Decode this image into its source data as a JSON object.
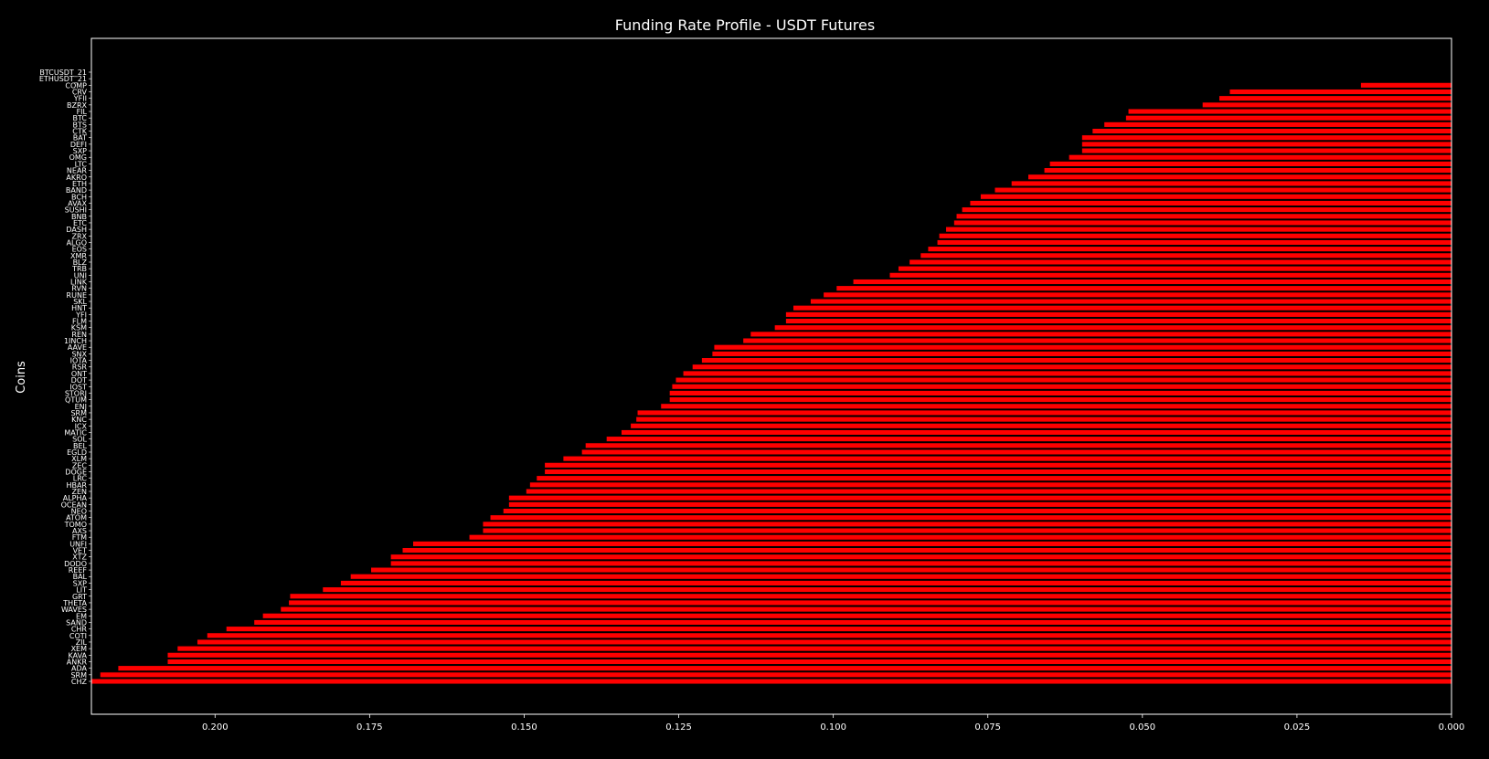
{
  "chart_data": {
    "type": "bar",
    "orientation": "horizontal",
    "title": "Funding Rate Profile - USDT Futures",
    "xlabel": "",
    "ylabel": "Coins",
    "xlim": [
      0.22,
      0.0
    ],
    "x_inverted": true,
    "grid": false,
    "legend": "none",
    "colors": {
      "background": "#000000",
      "bar": "#ff0000",
      "bar_edge": "#000000",
      "axis": "#ffffff",
      "text": "#ffffff"
    },
    "xticks": [
      0.2,
      0.175,
      0.15,
      0.125,
      0.1,
      0.075,
      0.05,
      0.025,
      0.0
    ],
    "xtick_labels": [
      "0.200",
      "0.175",
      "0.150",
      "0.125",
      "0.100",
      "0.075",
      "0.050",
      "0.025",
      "0.000"
    ],
    "categories": [
      "BTCUSDT_21",
      "ETHUSDT_21",
      "COMP",
      "CRV",
      "YFII",
      "BZRX",
      "FIL",
      "BTC",
      "BTS",
      "CTK",
      "BAT",
      "DEFI",
      "SXP",
      "OMG",
      "LTC",
      "NEAR",
      "AKRO",
      "ETH",
      "BAND",
      "BCH",
      "AVAX",
      "SUSHI",
      "BNB",
      "ETC",
      "DASH",
      "ZRX",
      "ALGO",
      "EOS",
      "XMR",
      "BLZ",
      "TRB",
      "UNI",
      "LINK",
      "RVN",
      "RUNE",
      "SKL",
      "HNT",
      "YFI",
      "FLM",
      "KSM",
      "REN",
      "1INCH",
      "AAVE",
      "SNX",
      "IOTA",
      "RSR",
      "ONT",
      "DOT",
      "IOST",
      "STORJ",
      "QTUM",
      "ENJ",
      "SRM",
      "KNC",
      "ICX",
      "MATIC",
      "SOL",
      "BEL",
      "EGLD",
      "XLM",
      "ZEC",
      "DOGE",
      "LRC",
      "HBAR",
      "ZEN",
      "ALPHA",
      "OCEAN",
      "NEO",
      "ATOM",
      "TOMO",
      "AXS",
      "FTM",
      "UNFI",
      "VET",
      "XTZ",
      "DODO",
      "REEF",
      "BAL",
      "SXP",
      "LIT",
      "GRT",
      "THETA",
      "WAVES",
      "EM",
      "SAND",
      "CHR",
      "COTI",
      "ZIL",
      "XEM",
      "KAVA",
      "ANKR",
      "ADA",
      "SRM",
      "CHZ"
    ],
    "values": [
      0.0,
      0.0,
      0.0147,
      0.0359,
      0.0376,
      0.0403,
      0.0523,
      0.0527,
      0.0562,
      0.0581,
      0.0598,
      0.0598,
      0.0598,
      0.0619,
      0.065,
      0.0659,
      0.0685,
      0.0712,
      0.0739,
      0.0762,
      0.0779,
      0.0792,
      0.0801,
      0.0805,
      0.0818,
      0.0829,
      0.0832,
      0.0847,
      0.0859,
      0.0877,
      0.0895,
      0.0909,
      0.0968,
      0.0995,
      0.1016,
      0.1037,
      0.1065,
      0.1077,
      0.1077,
      0.1095,
      0.1134,
      0.1146,
      0.1193,
      0.1196,
      0.1213,
      0.1228,
      0.1243,
      0.1255,
      0.1261,
      0.1265,
      0.1265,
      0.1279,
      0.1317,
      0.1319,
      0.1328,
      0.1343,
      0.1367,
      0.1401,
      0.1407,
      0.1437,
      0.1467,
      0.1467,
      0.148,
      0.1491,
      0.1497,
      0.1525,
      0.1525,
      0.1534,
      0.1555,
      0.1567,
      0.1567,
      0.1589,
      0.168,
      0.1697,
      0.1716,
      0.1716,
      0.1748,
      0.1781,
      0.1797,
      0.1826,
      0.1879,
      0.1881,
      0.1894,
      0.1923,
      0.1937,
      0.1982,
      0.2013,
      0.2029,
      0.2061,
      0.2077,
      0.2077,
      0.2157,
      0.2186,
      0.22
    ]
  }
}
